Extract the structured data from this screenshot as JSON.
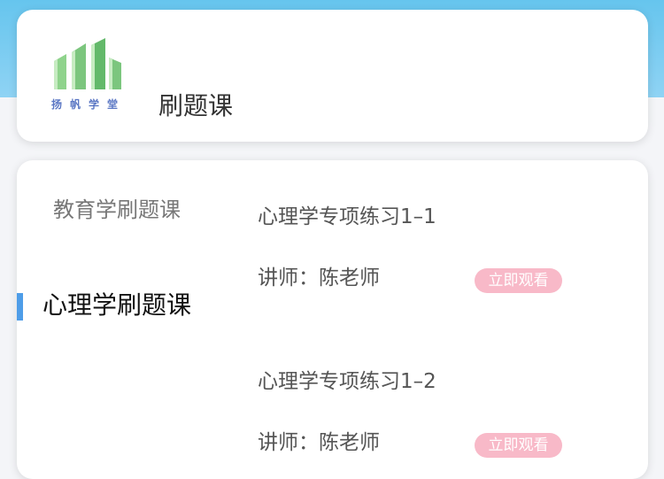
{
  "header": {
    "logo_text": "扬帆学堂",
    "title": "刷题课"
  },
  "categories": [
    {
      "label": "教育学刷题课"
    },
    {
      "label": "心理学刷题课"
    }
  ],
  "courses": [
    {
      "title": "心理学专项练习1–1",
      "teacher": "讲师：陈老师",
      "action": "立即观看"
    },
    {
      "title": "心理学专项练习1–2",
      "teacher": "讲师：陈老师",
      "action": "立即观看"
    }
  ],
  "colors": {
    "top_band": "#66c5ee",
    "active_indicator": "#4e9de8",
    "watch_button": "#f8b9c8",
    "logo_green": "#7cc67e",
    "logo_text": "#5b77c4"
  },
  "icons": {
    "logo": "building-logo-icon"
  }
}
